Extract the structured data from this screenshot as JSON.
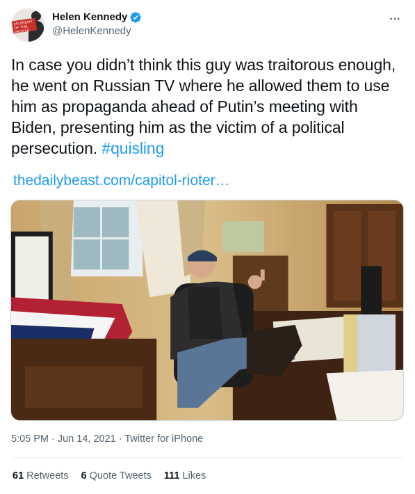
{
  "author": {
    "display_name": "Helen Kennedy",
    "handle": "@HelenKennedy",
    "avatar_text": "AN ENEMY OF THE PEOPLE",
    "verified_color": "#1d9bf0"
  },
  "tweet": {
    "text": "In case you didn’t think this guy was traitorous enough, he went on Russian TV where he allowed them to use him as propaganda ahead of Putin’s meeting with Biden, presenting him as the victim of a political persecution. ",
    "hashtag": "#quisling",
    "link": "thedailybeast.com/capitol-rioter…"
  },
  "meta": {
    "time": "5:05 PM",
    "date": "Jun 14, 2021",
    "source": "Twitter for iPhone",
    "separator": " · "
  },
  "stats": {
    "retweets_count": "61",
    "retweets_label": "Retweets",
    "quotes_count": "6",
    "quotes_label": "Quote Tweets",
    "likes_count": "111",
    "likes_label": "Likes"
  },
  "colors": {
    "link": "#1d9bf0",
    "secondary_text": "#536471",
    "primary_text": "#0f1419"
  },
  "icons": {
    "more": "more-horizontal-icon",
    "verified": "verified-badge-icon"
  }
}
